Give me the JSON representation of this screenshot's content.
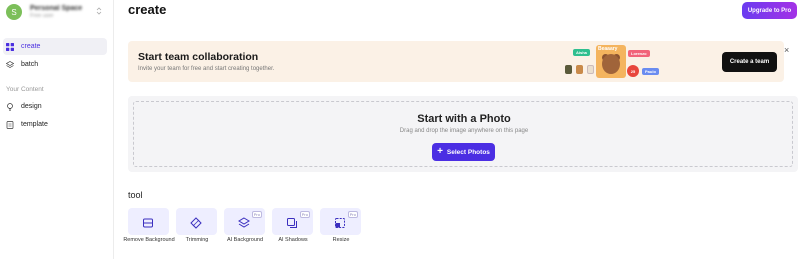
{
  "account": {
    "avatar_letter": "S",
    "name": "Personal Space",
    "sub": "Free user"
  },
  "sidebar": {
    "items": [
      {
        "label": "create",
        "icon": "grid-icon",
        "active": true
      },
      {
        "label": "batch",
        "icon": "layers-icon",
        "active": false
      }
    ],
    "section_label": "Your Content",
    "content_items": [
      {
        "label": "design",
        "icon": "bulb-icon"
      },
      {
        "label": "template",
        "icon": "document-icon"
      }
    ]
  },
  "header": {
    "title": "create",
    "upgrade_label": "Upgrade to Pro"
  },
  "banner": {
    "title": "Start team collaboration",
    "subtitle": "Invite your team for free and start creating together.",
    "button_label": "Create a team",
    "close_label": "×",
    "illustration": {
      "tags": [
        "Aisha",
        "Lorenzo",
        "Paulo"
      ],
      "card_title": "Beaaary",
      "badge": "25"
    }
  },
  "upload": {
    "title": "Start with a Photo",
    "subtitle": "Drag and drop the image anywhere on this page",
    "button_label": "Select Photos",
    "button_icon": "+"
  },
  "tools": {
    "heading": "tool",
    "pro_badge": "Pro",
    "items": [
      {
        "label": "Remove Background",
        "icon": "remove-bg-icon",
        "pro": false
      },
      {
        "label": "Trimming",
        "icon": "trim-icon",
        "pro": false
      },
      {
        "label": "AI Background",
        "icon": "ai-background-icon",
        "pro": true
      },
      {
        "label": "AI Shadows",
        "icon": "ai-shadows-icon",
        "pro": true
      },
      {
        "label": "Resize",
        "icon": "resize-icon",
        "pro": true
      }
    ]
  },
  "colors": {
    "accent": "#4b2ee3",
    "banner_bg": "#fbf1e6",
    "tool_bg": "#eeeeff",
    "upgrade_gradient": [
      "#6a3cf0",
      "#a431e6"
    ]
  }
}
